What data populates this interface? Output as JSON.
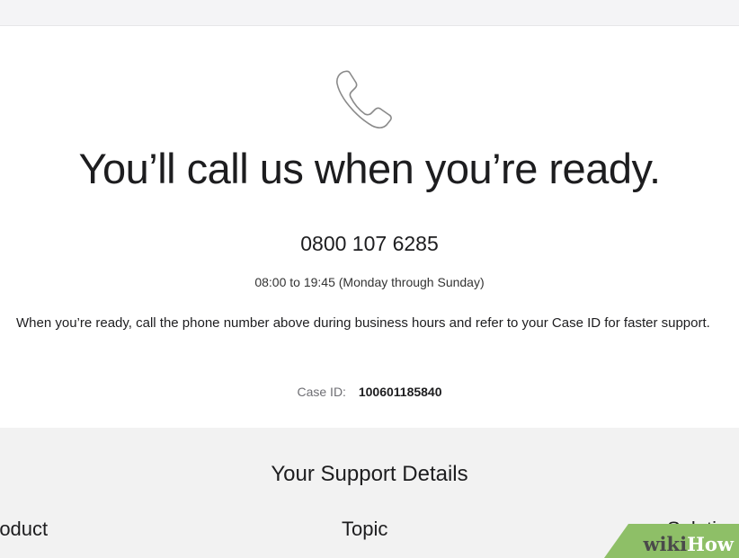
{
  "header": {
    "icon": "phone-handset-icon",
    "headline": "You’ll call us when you’re ready."
  },
  "contact": {
    "phone_number": "0800 107 6285",
    "hours": "08:00 to 19:45 (Monday through Sunday)",
    "instructions": "When you’re ready, call the phone number above during business hours and refer to your Case ID for faster support."
  },
  "case": {
    "label": "Case ID:",
    "value": "100601185840"
  },
  "support_details": {
    "title": "Your Support Details",
    "columns": {
      "product": "roduct",
      "topic": "Topic",
      "solution": "Solution"
    }
  },
  "watermark": {
    "wiki": "wiki",
    "how": "How",
    "color": "#8ebf67"
  },
  "colors": {
    "text": "#1d1d1f",
    "muted": "#6e6e73",
    "section_bg": "#f2f2f2"
  }
}
